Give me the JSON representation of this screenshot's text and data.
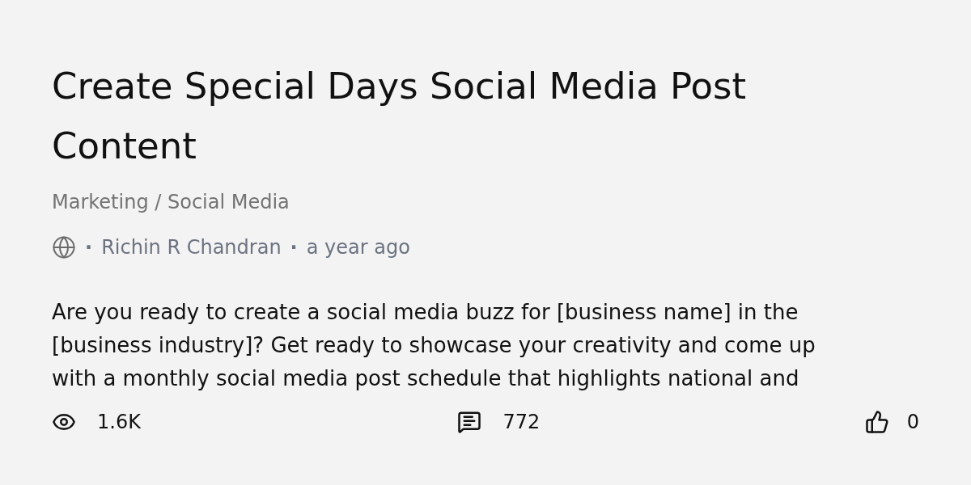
{
  "post": {
    "title": "Create Special Days Social Media Post Content",
    "category": "Marketing / Social Media",
    "meta": [
      {
        "kind": "separator",
        "text": "·"
      },
      {
        "kind": "author",
        "text": "Richin R Chandran"
      },
      {
        "kind": "separator",
        "text": "·"
      },
      {
        "kind": "time",
        "text": "a year ago"
      }
    ],
    "description": "Are you ready to create a social media buzz for [business name] in the [business industry]? Get ready to showcase your creativity and come up with a monthly social media post schedule that highlights national and"
  },
  "stats": [
    {
      "kind": "views",
      "value": "1.6K"
    },
    {
      "kind": "comments",
      "value": "772"
    },
    {
      "kind": "likes",
      "value": "0"
    }
  ]
}
